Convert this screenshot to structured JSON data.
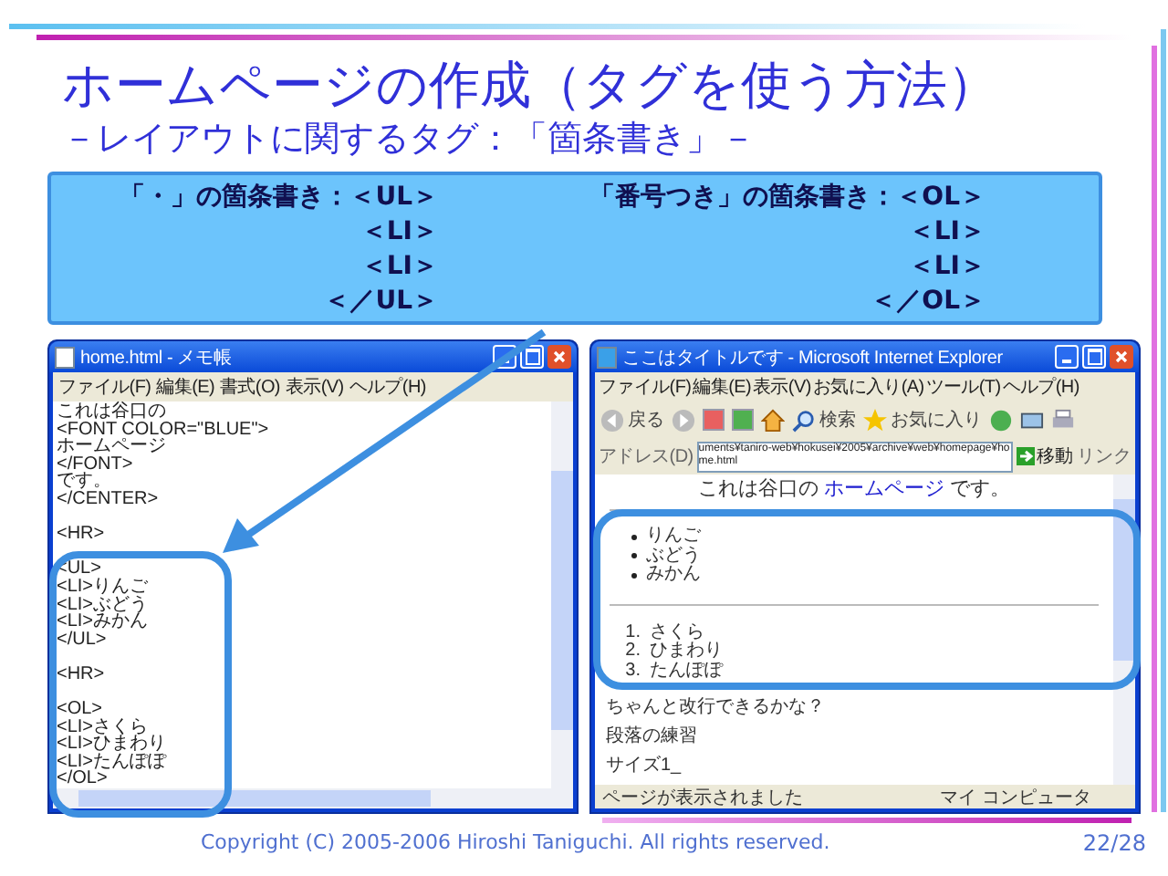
{
  "title": "ホームページの作成（タグを使う方法）",
  "subtitle": "－レイアウトに関するタグ：「箇条書き」－",
  "callout": {
    "columns": [
      {
        "heading": "「・」の箇条書き：＜UL＞",
        "lines": [
          "＜LI＞",
          "＜LI＞",
          "＜／UL＞"
        ]
      },
      {
        "heading": "「番号つき」の箇条書き：＜OL＞",
        "lines": [
          "＜LI＞",
          "＜LI＞",
          "＜／OL＞"
        ]
      }
    ]
  },
  "notepad": {
    "title": "home.html - メモ帳",
    "menu": [
      "ファイル(F)",
      "編集(E)",
      "書式(O)",
      "表示(V)",
      "ヘルプ(H)"
    ],
    "blocks": [
      [
        "これは谷口の",
        "<FONT COLOR=\"BLUE\">",
        "ホームページ",
        "</FONT>",
        "です。",
        "</CENTER>"
      ],
      [
        "<HR>"
      ],
      [
        "<UL>",
        "<LI>りんご",
        "<LI>ぶどう",
        "<LI>みかん",
        "</UL>"
      ],
      [
        "<HR>"
      ],
      [
        "<OL>",
        "<LI>さくら",
        "<LI>ひまわり",
        "<LI>たんぽぽ",
        "</OL>"
      ]
    ]
  },
  "browser": {
    "title": "ここはタイトルです - Microsoft Internet Explorer",
    "menu": [
      "ファイル(F)",
      "編集(E)",
      "表示(V)",
      "お気に入り(A)",
      "ツール(T)",
      "ヘルプ(H)"
    ],
    "toolbar": {
      "back": "戻る",
      "search": "検索",
      "favorites": "お気に入り"
    },
    "address_label": "アドレス(D)",
    "address": "uments¥taniro-web¥hokusei¥2005¥archive¥web¥homepage¥home.html",
    "go": "移動",
    "links": "リンク",
    "heading": {
      "before": "これは谷口の",
      "colored": "ホームページ",
      "after": "です。"
    },
    "bullets": [
      "りんご",
      "ぶどう",
      "みかん"
    ],
    "numbered": [
      {
        "number": "1.",
        "text": "さくら"
      },
      {
        "number": "2.",
        "text": "ひまわり"
      },
      {
        "number": "3.",
        "text": "たんぽぽ"
      }
    ],
    "paragraphs": [
      "ちゃんと改行できるかな？",
      "段落の練習",
      "サイズ1_"
    ],
    "status": "ページが表示されました",
    "zone": "マイ コンピュータ"
  },
  "footer": {
    "copyright": "Copyright (C) 2005-2006 Hiroshi Taniguchi. All rights reserved.",
    "page": "22/28"
  }
}
